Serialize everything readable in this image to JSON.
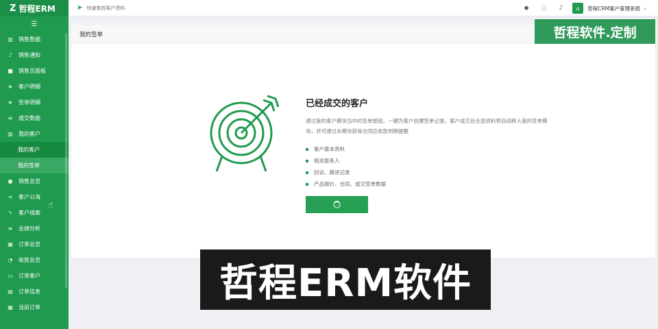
{
  "app": {
    "logo_mark": "Z",
    "logo_text": "哲程ERM",
    "collapse_icon": "menu-icon"
  },
  "sidebar": {
    "items": [
      {
        "label": "销售数据",
        "icon": "chart-icon"
      },
      {
        "label": "销售通知",
        "icon": "bell-icon"
      },
      {
        "label": "销售员面板",
        "icon": "video-icon"
      },
      {
        "label": "客户明细",
        "icon": "send-icon"
      },
      {
        "label": "签单明细",
        "icon": "send-icon"
      },
      {
        "label": "成交数据",
        "icon": "list-icon"
      },
      {
        "label": "我的客户",
        "icon": "chart-icon"
      },
      {
        "label": "我的客户",
        "icon": ""
      },
      {
        "label": "我的签单",
        "icon": ""
      },
      {
        "label": "销售总览",
        "icon": "eye-icon"
      },
      {
        "label": "客户公海",
        "icon": "share-icon"
      },
      {
        "label": "客户线索",
        "icon": "bolt-icon"
      },
      {
        "label": "业绩分析",
        "icon": "list-icon"
      },
      {
        "label": "订单总览",
        "icon": "grid-icon"
      },
      {
        "label": "收款总览",
        "icon": "rss-icon"
      },
      {
        "label": "订单客户",
        "icon": "window-icon"
      },
      {
        "label": "订单信息",
        "icon": "doc-icon"
      },
      {
        "label": "当前订单",
        "icon": "grid-icon"
      }
    ]
  },
  "topbar": {
    "search_placeholder": "快速查找客户资料",
    "user_name": "哲程CRM客户管理系统",
    "avatar_glyph": "⌂"
  },
  "page": {
    "title": "我的签单",
    "info_title": "已经成交的客户",
    "info_desc": "通过我的客户模块当中的签单按钮，一键为客户创建签单记录，客户成交后全部资料将自动移入我的签单模块，并可通过本模块获得合同应收款到期提醒",
    "features": [
      "客户基本资料",
      "相关联系人",
      "回访、跟进记录",
      "产品报价、合同、成交签单数据"
    ]
  },
  "overlay": {
    "banner": "哲程软件.定制",
    "caption": "哲程ERM软件"
  },
  "colors": {
    "brand": "#1f9a4e",
    "button": "#27a055"
  }
}
